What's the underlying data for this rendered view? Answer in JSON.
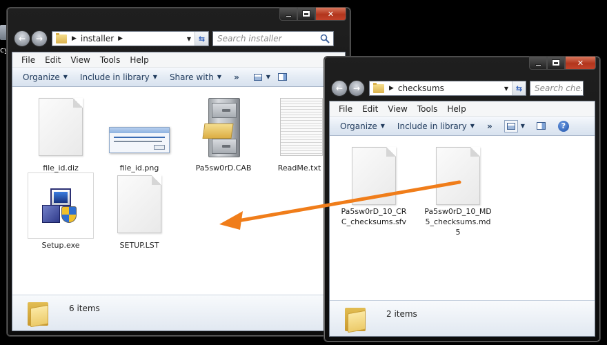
{
  "desktop": {
    "edge_label": "cy"
  },
  "windows": {
    "installer": {
      "path_segment": "installer",
      "search_placeholder": "Search installer",
      "menus": [
        "File",
        "Edit",
        "View",
        "Tools",
        "Help"
      ],
      "commands": {
        "organize": "Organize",
        "include": "Include in library",
        "share": "Share with",
        "more": "»"
      },
      "files": [
        {
          "name": "file_id.diz",
          "icon": "document-icon"
        },
        {
          "name": "file_id.png",
          "icon": "image-thumbnail-icon"
        },
        {
          "name": "Pa5sw0rD.CAB",
          "icon": "cabinet-archive-icon"
        },
        {
          "name": "ReadMe.txt",
          "icon": "text-document-icon"
        },
        {
          "name": "Setup.exe",
          "icon": "setup-installer-icon"
        },
        {
          "name": "SETUP.LST",
          "icon": "document-icon"
        }
      ],
      "status": "6 items"
    },
    "checksums": {
      "path_segment": "checksums",
      "search_placeholder": "Search che...",
      "menus": [
        "File",
        "Edit",
        "View",
        "Tools",
        "Help"
      ],
      "commands": {
        "organize": "Organize",
        "include": "Include in library",
        "more": "»"
      },
      "files": [
        {
          "name": "Pa5sw0rD_10_CRC_checksums.sfv",
          "icon": "document-icon"
        },
        {
          "name": "Pa5sw0rD_10_MD5_checksums.md5",
          "icon": "document-icon"
        }
      ],
      "status": "2 items"
    }
  },
  "colors": {
    "arrow": "#f07d1a",
    "command_text": "#1e395b",
    "close_button": "#c2422a"
  }
}
